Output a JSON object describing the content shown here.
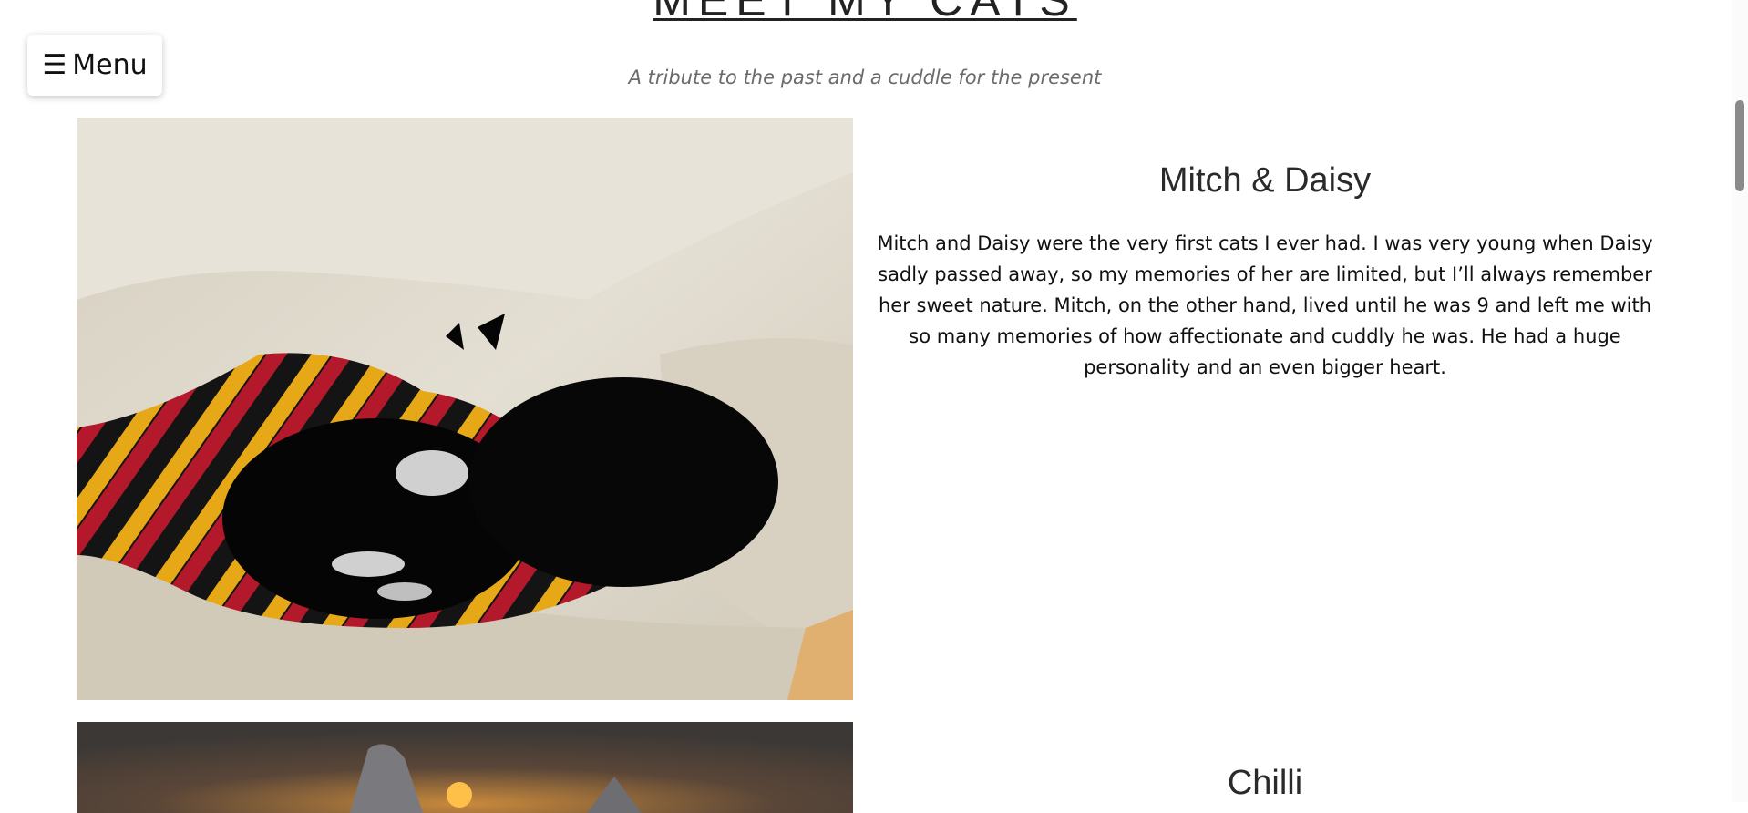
{
  "header": {
    "title": "MEET MY CATS",
    "tagline": "A tribute to the past and a cuddle for the present"
  },
  "menu": {
    "icon_glyph": "☰",
    "icon_name": "hamburger-icon",
    "label": "Menu"
  },
  "cats": [
    {
      "name": "Mitch & Daisy",
      "bio": "Mitch and Daisy were the very first cats I ever had. I was very young when Daisy sadly passed away, so my memories of her are limited, but I’ll always remember her sweet nature. Mitch, on the other hand, lived until he was 9 and left me with so many memories of how affectionate and cuddly he was. He had a huge personality and an even bigger heart."
    },
    {
      "name": "Chilli",
      "bio": ""
    }
  ],
  "colors": {
    "text": "#222222",
    "tagline": "#6b6b6b",
    "sofa": "#d9d3c4",
    "blanket_red": "#b3192a",
    "blanket_yellow": "#e6a816"
  }
}
